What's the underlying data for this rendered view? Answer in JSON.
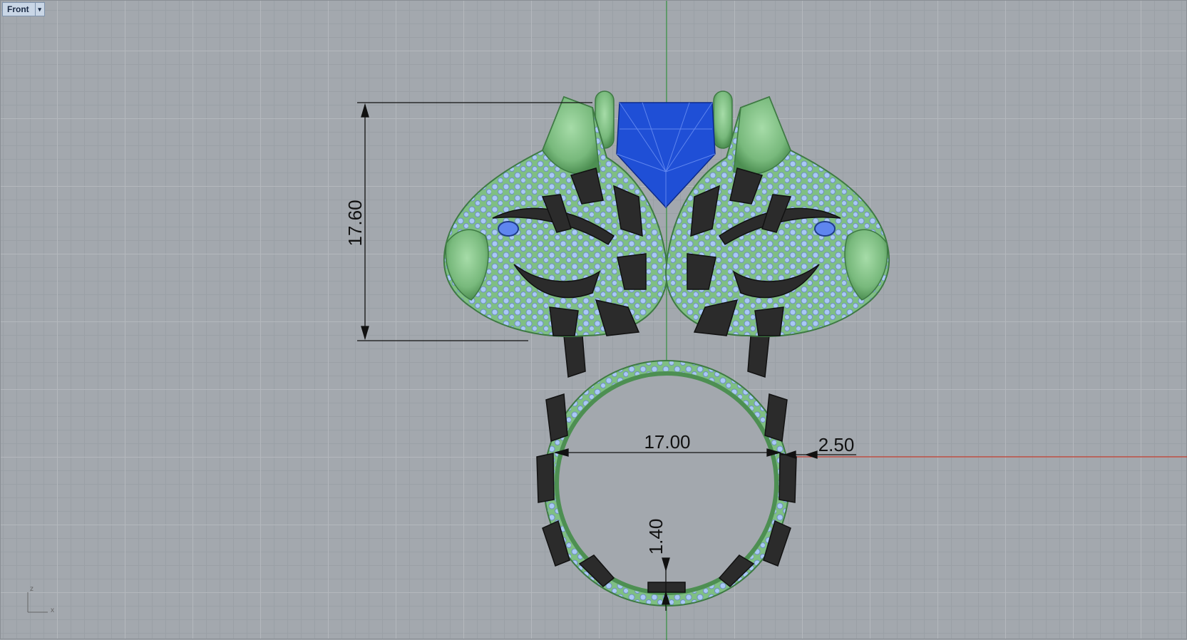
{
  "viewport": {
    "name": "Front",
    "dropdown_icon": "chevron-down-icon"
  },
  "axis_indicator": {
    "z": "z",
    "x": "x"
  },
  "dimensions": {
    "height": "17.60",
    "inner_diameter": "17.00",
    "band_width": "2.50",
    "band_thickness": "1.40"
  },
  "colors": {
    "grid_background": "#a3a8ae",
    "x_axis": "#c0392b",
    "z_axis": "#2e8b3a",
    "ring_green": "#7fbf83",
    "gem_blue": "#1f4fd6",
    "pave_blue": "#a9c8f5",
    "enamel_black": "#2b2b2b"
  }
}
